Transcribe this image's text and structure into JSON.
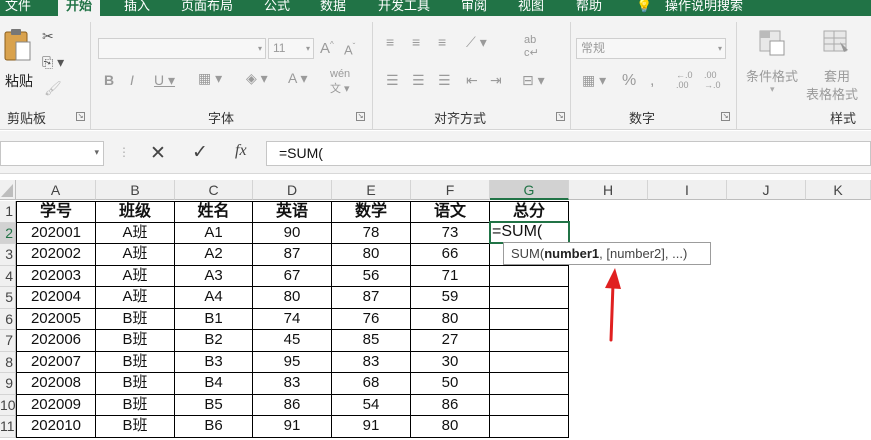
{
  "tabs": [
    "文件",
    "开始",
    "插入",
    "页面布局",
    "公式",
    "数据",
    "开发工具",
    "审阅",
    "视图",
    "帮助",
    "操作说明搜索"
  ],
  "active_tab": "开始",
  "groups": {
    "clipboard": {
      "label": "剪贴板",
      "paste": "粘贴"
    },
    "font": {
      "label": "字体",
      "size": "11"
    },
    "alignment": {
      "label": "对齐方式"
    },
    "number": {
      "label": "数字",
      "format": "常规"
    },
    "styles": {
      "label": "样式",
      "conditional": "条件格式",
      "table_format_1": "套用",
      "table_format_2": "表格格式"
    }
  },
  "formula_bar": {
    "cancel": "✕",
    "enter": "✓",
    "fx": "fx",
    "value": "=SUM("
  },
  "columns": [
    "A",
    "B",
    "C",
    "D",
    "E",
    "F",
    "G",
    "H",
    "I",
    "J",
    "K"
  ],
  "rows": [
    "1",
    "2",
    "3",
    "4",
    "5",
    "6",
    "7",
    "8",
    "9",
    "10",
    "11"
  ],
  "header_row": [
    "学号",
    "班级",
    "姓名",
    "英语",
    "数学",
    "语文",
    "总分"
  ],
  "data_rows": [
    [
      "202001",
      "A班",
      "A1",
      "90",
      "78",
      "73"
    ],
    [
      "202002",
      "A班",
      "A2",
      "87",
      "80",
      "66"
    ],
    [
      "202003",
      "A班",
      "A3",
      "67",
      "56",
      "71"
    ],
    [
      "202004",
      "A班",
      "A4",
      "80",
      "87",
      "59"
    ],
    [
      "202005",
      "B班",
      "B1",
      "74",
      "76",
      "80"
    ],
    [
      "202006",
      "B班",
      "B2",
      "45",
      "85",
      "27"
    ],
    [
      "202007",
      "B班",
      "B3",
      "95",
      "83",
      "30"
    ],
    [
      "202008",
      "B班",
      "B4",
      "83",
      "68",
      "50"
    ],
    [
      "202009",
      "B班",
      "B5",
      "86",
      "54",
      "86"
    ],
    [
      "202010",
      "B班",
      "B6",
      "91",
      "91",
      "80"
    ]
  ],
  "active_cell": {
    "ref": "G2",
    "value": "=SUM("
  },
  "tooltip": {
    "fn": "SUM(",
    "bold_arg": "number1",
    "rest": ", [number2], ...)"
  },
  "colors": {
    "accent": "#217346",
    "arrow": "#e02020"
  }
}
